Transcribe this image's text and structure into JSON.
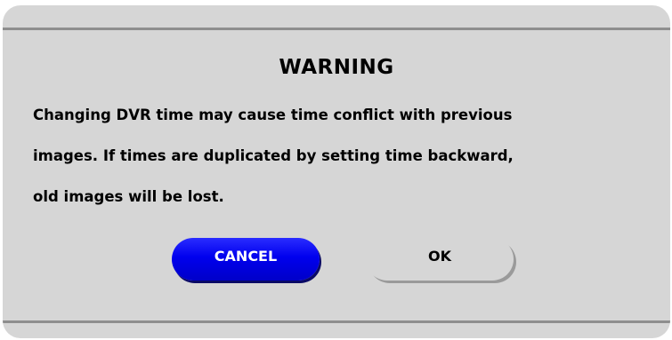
{
  "dialog": {
    "title": "WARNING",
    "message_lines": [
      "Changing DVR time may cause time conflict with previous",
      "images. If times are duplicated by setting time backward,",
      "old images will be lost."
    ],
    "buttons": {
      "cancel_label": "CANCEL",
      "ok_label": "OK"
    }
  },
  "colors": {
    "dialog_background": "#d6d6d6",
    "rule": "#8e8e8e",
    "cancel_button": "#0000ee",
    "text": "#000000"
  }
}
